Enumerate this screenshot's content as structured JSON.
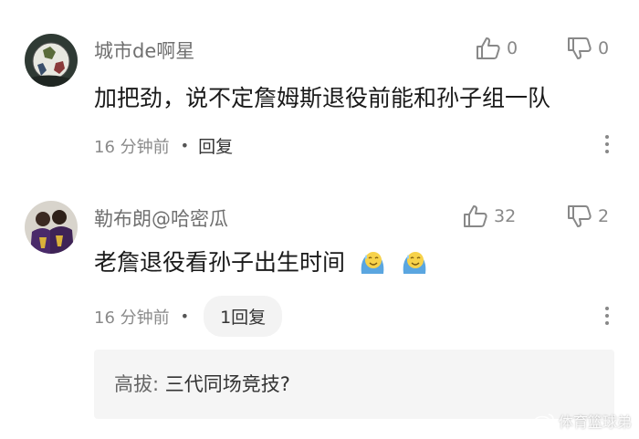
{
  "comments": [
    {
      "username": "城市de啊星",
      "text": "加把劲，说不定詹姆斯退役前能和孙子组一队",
      "time": "16 分钟前",
      "reply_label": "回复",
      "likes": "0",
      "dislikes": "0",
      "avatar_icon": "soccer-ball-avatar"
    },
    {
      "username": "勒布朗@哈密瓜",
      "text": "老詹退役看孙子出生时间",
      "time": "16 分钟前",
      "reply_label": "1回复",
      "likes": "32",
      "dislikes": "2",
      "avatar_icon": "players-avatar",
      "emojis": [
        "sweat-smile-emoji",
        "sweat-smile-emoji"
      ],
      "subreply": {
        "name": "高拔:",
        "text": "三代同场竞技?"
      }
    }
  ],
  "watermark": "体育篮球弟",
  "colors": {
    "text": "#1a1a1a",
    "muted": "#8a8a8a",
    "subreply_bg": "#f5f5f5"
  }
}
